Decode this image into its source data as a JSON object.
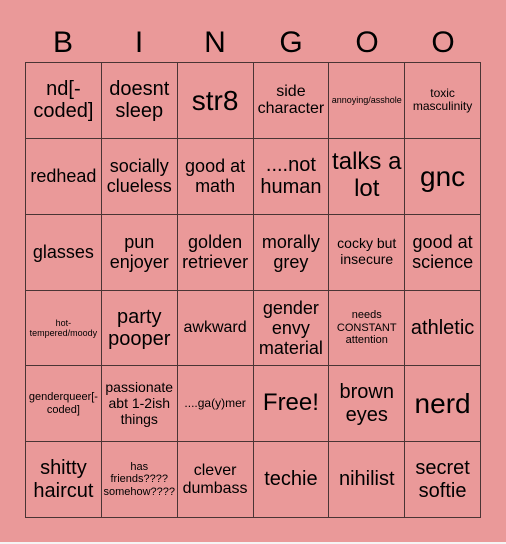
{
  "header": {
    "letters": [
      "B",
      "I",
      "N",
      "G",
      "O",
      "O"
    ]
  },
  "colors": {
    "card_background": "#ea9999",
    "grid_lines": "#4a3434",
    "text": "#000000"
  },
  "cells": [
    [
      "nd[-coded]",
      "doesnt sleep",
      "str8",
      "side character",
      "annoying/asshole",
      "toxic masculinity"
    ],
    [
      "redhead",
      "socially clueless",
      "good at math",
      "....not human",
      "talks a lot",
      "gnc"
    ],
    [
      "glasses",
      "pun enjoyer",
      "golden retriever",
      "morally grey",
      "cocky but insecure",
      "good at science"
    ],
    [
      "hot-tempered/moody",
      "party pooper",
      "awkward",
      "gender envy material",
      "needs CONSTANT attention",
      "athletic"
    ],
    [
      "genderqueer[-coded]",
      "passionate abt 1-2ish things",
      "....ga(y)mer",
      "Free!",
      "brown eyes",
      "nerd"
    ],
    [
      "shitty haircut",
      "has friends???? somehow????",
      "clever dumbass",
      "techie",
      "nihilist",
      "secret softie"
    ]
  ]
}
